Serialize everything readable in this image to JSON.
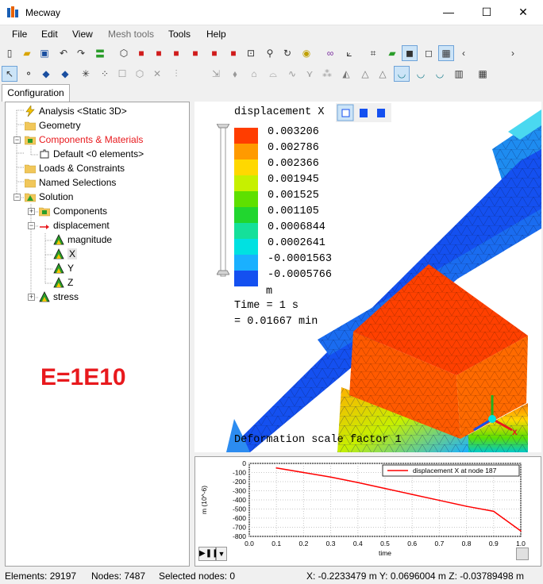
{
  "window": {
    "title": "Mecway",
    "min": "—",
    "max": "☐",
    "close": "✕"
  },
  "menu": [
    "File",
    "Edit",
    "View",
    "Mesh tools",
    "Tools",
    "Help"
  ],
  "tab": "Configuration",
  "tree": [
    {
      "label": "Analysis <Static 3D>",
      "icon": "lightning-icon",
      "color": "#000000"
    },
    {
      "label": "Geometry",
      "icon": "folder-icon",
      "color": "#000000"
    },
    {
      "label": "Components & Materials",
      "icon": "components-icon",
      "color": "#e8191d"
    },
    {
      "label": "Default <0 elements>",
      "icon": "puzzle-icon",
      "color": "#000000"
    },
    {
      "label": "Loads & Constraints",
      "icon": "folder-icon",
      "color": "#000000"
    },
    {
      "label": "Named Selections",
      "icon": "folder-icon",
      "color": "#000000"
    },
    {
      "label": "Solution",
      "icon": "solution-icon",
      "color": "#000000"
    },
    {
      "label": "Components",
      "icon": "components-icon",
      "color": "#000000"
    },
    {
      "label": "displacement",
      "icon": "arrow-icon",
      "color": "#000000"
    },
    {
      "label": "magnitude",
      "icon": "triangle-icon",
      "color": "#000000"
    },
    {
      "label": "X",
      "icon": "triangle-icon",
      "color": "#000000"
    },
    {
      "label": "Y",
      "icon": "triangle-icon",
      "color": "#000000"
    },
    {
      "label": "Z",
      "icon": "triangle-icon",
      "color": "#000000"
    },
    {
      "label": "stress",
      "icon": "triangle-icon",
      "color": "#000000"
    }
  ],
  "annotation": "E=1E10",
  "legend": {
    "title": "displacement X",
    "unit": "m",
    "values": [
      "0.003206",
      "0.002786",
      "0.002366",
      "0.001945",
      "0.001525",
      "0.001105",
      "0.0006844",
      "0.0002641",
      "-0.0001563",
      "-0.0005766"
    ],
    "colors": [
      "#ff3d00",
      "#ff9a00",
      "#ffd800",
      "#c6f000",
      "#5ee000",
      "#21d62f",
      "#15e09a",
      "#00e1e1",
      "#1ab0ff",
      "#1450f0"
    ]
  },
  "time_lines": [
    "Time = 1 s",
    "= 0.01667 min"
  ],
  "deformation_label": "Deformation scale factor 1",
  "chart_data": {
    "type": "line",
    "series": [
      {
        "name": "displacement X at node 187",
        "color": "#ff0000",
        "x": [
          0.1,
          0.2,
          0.3,
          0.4,
          0.5,
          0.6,
          0.7,
          0.8,
          0.9,
          1.0
        ],
        "y": [
          -50,
          -100,
          -150,
          -210,
          -275,
          -340,
          -405,
          -470,
          -525,
          -740
        ]
      }
    ],
    "xlabel": "time",
    "ylabel": "m (10^-6)",
    "xlim": [
      0,
      1
    ],
    "ylim": [
      -800,
      0
    ],
    "xticks": [
      "0.0",
      "0.1",
      "0.2",
      "0.3",
      "0.4",
      "0.5",
      "0.6",
      "0.7",
      "0.8",
      "0.9",
      "1.0"
    ],
    "yticks": [
      "0",
      "-100",
      "-200",
      "-300",
      "-400",
      "-500",
      "-600",
      "-700",
      "-800"
    ],
    "grid": true,
    "legend": "top-right"
  },
  "status": {
    "elements": "Elements: 29197",
    "nodes": "Nodes: 7487",
    "selected": "Selected nodes: 0",
    "coords": "X: -0.2233479 m Y: 0.0696004 m Z: -0.03789498 m"
  }
}
